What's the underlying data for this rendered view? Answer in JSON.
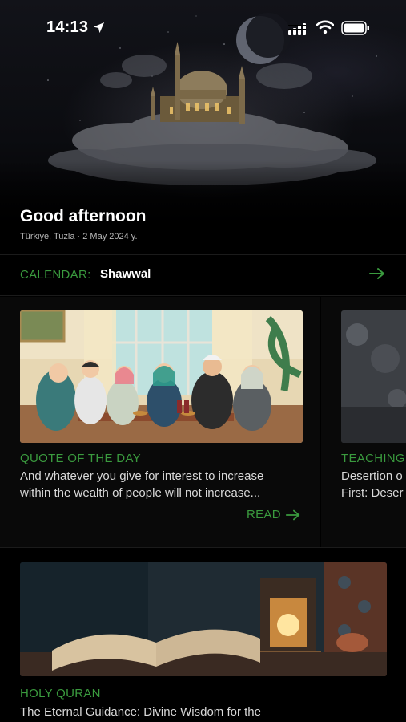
{
  "status_bar": {
    "time": "14:13"
  },
  "header": {
    "greeting": "Good afternoon",
    "location_date": "Türkiye, Tuzla · 2 May 2024 y."
  },
  "calendar": {
    "label": "CALENDAR:",
    "value": "Shawwāl"
  },
  "cards": [
    {
      "category": "QUOTE OF THE DAY",
      "text_line1": "And whatever you give for interest to increase",
      "text_line2": "within the wealth of people will not increase...",
      "action": "READ"
    },
    {
      "category": "TEACHING",
      "text_line1": "Desertion o",
      "text_line2": "First: Deser"
    }
  ],
  "bottom_card": {
    "category": "HOLY QURAN",
    "text": "The Eternal Guidance: Divine Wisdom for the"
  },
  "colors": {
    "accent": "#3a9a3e",
    "background": "#000000",
    "text": "#ffffff"
  },
  "icons": [
    "location-arrow-icon",
    "signal-icon",
    "wifi-icon",
    "battery-icon",
    "arrow-right-icon"
  ]
}
